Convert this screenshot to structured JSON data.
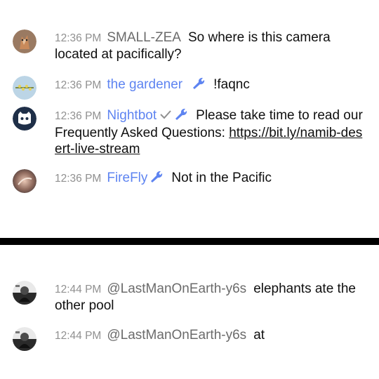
{
  "messages_top": [
    {
      "time": "12:36 PM",
      "author": "SMALL-ZEA",
      "text": "So where is this camera located at pacifically?"
    },
    {
      "time": "12:36 PM",
      "author": "the gardener",
      "text": "!faqnc"
    },
    {
      "time": "12:36 PM",
      "author": "Nightbot",
      "text_before_link": "Please take time to read our Frequently Asked Questions: ",
      "link": "https://bit.ly/namib-desert-live-stream"
    },
    {
      "time": "12:36 PM",
      "author": "FireFly",
      "text": "Not in the Pacific"
    }
  ],
  "messages_bottom": [
    {
      "time": "12:44 PM",
      "author": "@LastManOnEarth-y6s",
      "text": "elephants ate the other pool"
    },
    {
      "time": "12:44 PM",
      "author": "@LastManOnEarth-y6s",
      "text": "at"
    }
  ],
  "colors": {
    "moderator_blue": "#5e84f1",
    "author_gray": "#6b6b6b",
    "timestamp_gray": "#909090",
    "divider": "#000000"
  }
}
